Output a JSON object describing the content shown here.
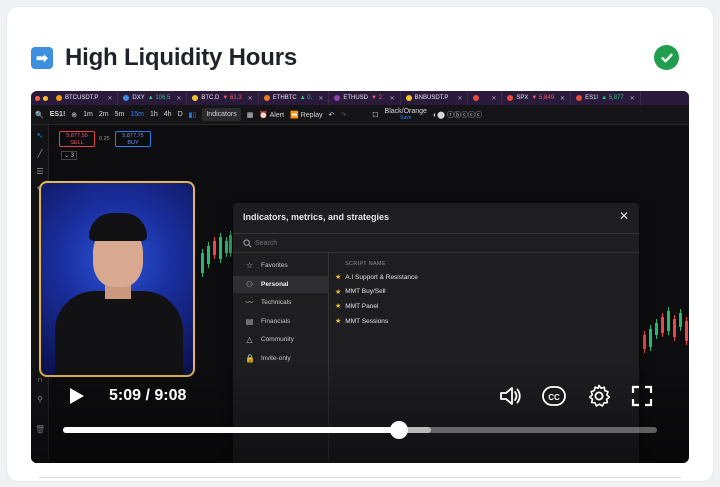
{
  "lesson": {
    "title": "High Liquidity Hours",
    "arrow_icon": "right-arrow-icon",
    "status_icon": "check-circle-icon",
    "status_color": "#1f9e4e"
  },
  "browser_tabs": [
    {
      "symbol": "BTCUSDT.P",
      "change": "",
      "dir": ""
    },
    {
      "symbol": "DXY",
      "change": "▲ 106.5",
      "dir": "pos"
    },
    {
      "symbol": "BTC.D",
      "change": "▼ 61.3",
      "dir": "neg"
    },
    {
      "symbol": "ETHBTC",
      "change": "▲ 0.",
      "dir": "pos"
    },
    {
      "symbol": "ETHUSD",
      "change": "▼ 2.",
      "dir": "neg"
    },
    {
      "symbol": "BNBUSDT.P",
      "change": "",
      "dir": ""
    },
    {
      "symbol": "",
      "change": "",
      "dir": ""
    },
    {
      "symbol": "SPX",
      "change": "▼ 5,849",
      "dir": "neg"
    },
    {
      "symbol": "ES1!",
      "change": "▲ 5,877",
      "dir": "pos"
    }
  ],
  "toolbar": {
    "symbol": "ES1!",
    "timeframes": [
      "1m",
      "2m",
      "5m",
      "15m",
      "1h",
      "4h",
      "D"
    ],
    "active_timeframe": "15m",
    "indicators_label": "Indicators",
    "alert_label": "Alert",
    "replay_label": "Replay",
    "layout_name": "Black/Orange",
    "layout_sub": "Save"
  },
  "order_panel": {
    "sell_price": "5,877.50",
    "sell_label": "SELL",
    "spread": "0.25",
    "buy_price": "5,877.75",
    "buy_label": "BUY",
    "quantity": "3"
  },
  "dialog": {
    "title": "Indicators, metrics, and strategies",
    "search_placeholder": "Search",
    "column_header": "SCRIPT NAME",
    "categories": [
      {
        "label": "Favorites",
        "icon": "star-icon",
        "active": false
      },
      {
        "label": "Personal",
        "icon": "user-icon",
        "active": true
      },
      {
        "label": "Technicals",
        "icon": "chart-icon",
        "active": false
      },
      {
        "label": "Financials",
        "icon": "financials-icon",
        "active": false
      },
      {
        "label": "Community",
        "icon": "community-icon",
        "active": false
      },
      {
        "label": "Invite-only",
        "icon": "lock-icon",
        "active": false
      }
    ],
    "scripts": [
      "A.I Support & Resistance",
      "MMT Buy/Sell",
      "MMT Panel",
      "MMT Sessions"
    ]
  },
  "player": {
    "current_time": "5:09",
    "duration": "9:08",
    "time_display": "5:09 / 9:08",
    "progress": 0.565,
    "buffered": 0.62,
    "icons": [
      "play-icon",
      "volume-icon",
      "captions-icon",
      "settings-icon",
      "fullscreen-icon"
    ]
  }
}
